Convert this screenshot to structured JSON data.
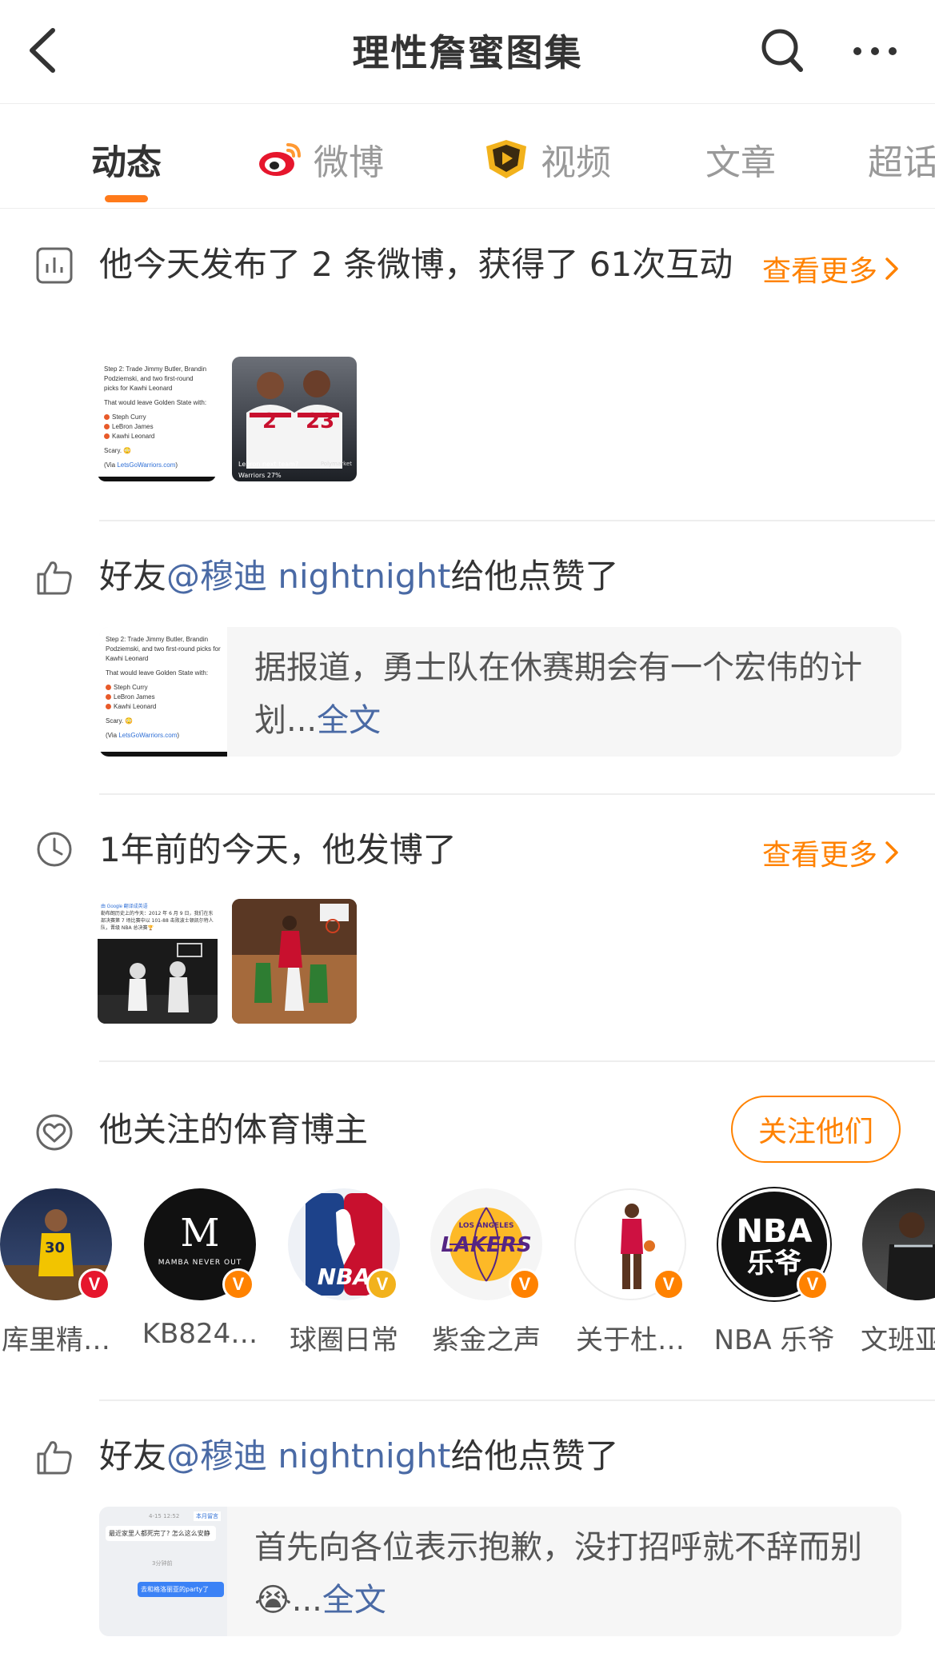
{
  "header": {
    "title": "理性詹蜜图集"
  },
  "tabs": [
    {
      "label": "动态"
    },
    {
      "label": "微博"
    },
    {
      "label": "视频"
    },
    {
      "label": "文章"
    },
    {
      "label": "超话"
    }
  ],
  "today": {
    "text": "他今天发布了 2 条微博，获得了 61次互动",
    "more": "查看更多"
  },
  "tweet_thumb": {
    "line1": "Step 2: Trade Jimmy Butler, Brandin Podziemski, and two first-round picks for Kawhi Leonard",
    "line2": "That would leave Golden State with:",
    "names": [
      "Steph Curry",
      "LeBron James",
      "Kawhi Leonard"
    ],
    "scary": "Scary. 😳",
    "via_prefix": "(Via ",
    "via_link": "LetsGoWarriors.com",
    "via_suffix": ")"
  },
  "photo_thumb": {
    "jersey_left": "2",
    "jersey_right": "23",
    "caption": "Lebron next team?",
    "poll_label": "Warriors",
    "poll_pct": "27%",
    "brand": "Polymarket"
  },
  "like1": {
    "prefix": "好友",
    "mention": "@穆迪 nightnight",
    "suffix": "给他点赞了",
    "card_text": "据报道，勇士队在休赛期会有一个宏伟的计划...",
    "full": "全文"
  },
  "memory": {
    "text": "1年前的今天，他发博了",
    "more": "查看更多"
  },
  "memory_thumb": {
    "source": "由 Google 翻译成英语",
    "text": "勒布朗历史上的今天：2012 年 6 月 9 日，我们在东部决赛第 7 场比赛中以 101-88 击败波士顿凯尔特人队，晋级 NBA 总决赛🏆"
  },
  "follow": {
    "title": "他关注的体育博主",
    "button": "关注他们",
    "users": [
      {
        "name": "库里精…",
        "jersey": "30"
      },
      {
        "name": "KB824…",
        "logo": "M",
        "sub": "MAMBA NEVER OUT"
      },
      {
        "name": "球圈日常",
        "logo": "NBA"
      },
      {
        "name": "紫金之声",
        "logo": "LAKERS",
        "sub": "LOS ANGELES"
      },
      {
        "name": "关于杜…"
      },
      {
        "name": "NBA 乐爷",
        "logo": "NBA",
        "sub": "乐爷"
      },
      {
        "name": "文班亚"
      }
    ],
    "badge": "V"
  },
  "like2": {
    "prefix": "好友",
    "mention": "@穆迪 nightnight",
    "suffix": "给他点赞了",
    "card_text": "首先向各位表示抱歉，没打招呼就不辞而别😭...",
    "full": "全文",
    "chat_time": "4-15 12:52",
    "chat_tag": "本月留言",
    "chat_msg1": "最近家里人都死完了? 怎么这么安静",
    "chat_time2": "3分钟前",
    "chat_msg2": "去和格洛丽亚的party了"
  },
  "colors": {
    "accent": "#ff8200",
    "mention": "#4a6aa5",
    "weibo_red": "#e6162d"
  }
}
